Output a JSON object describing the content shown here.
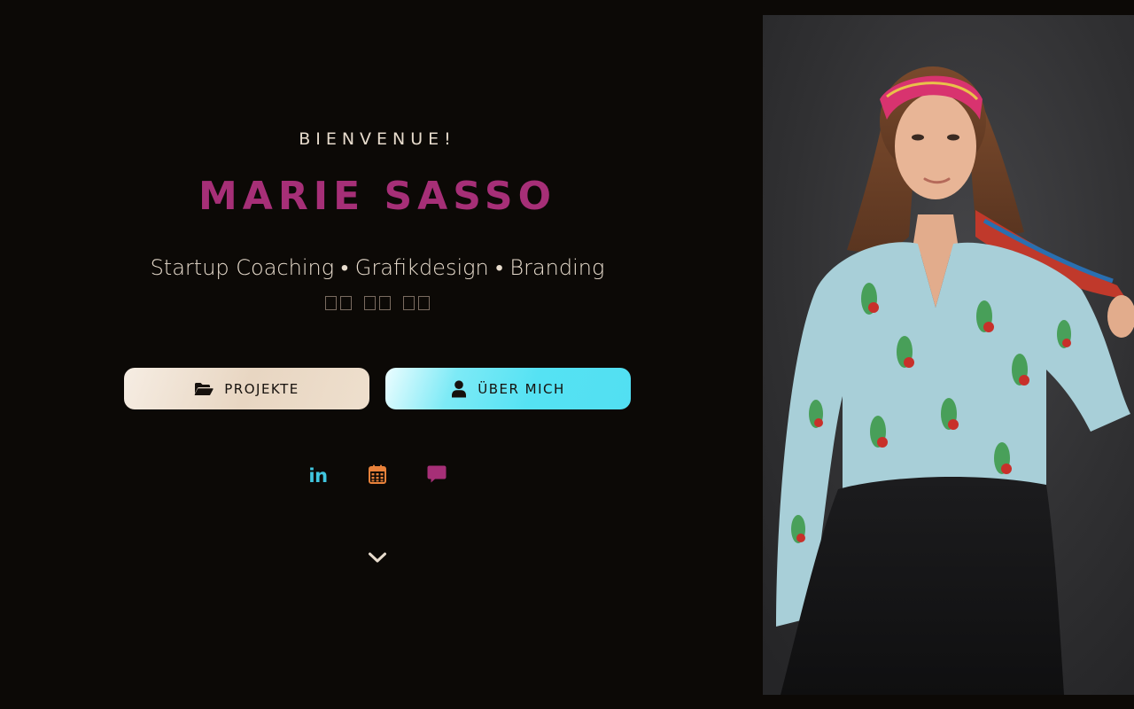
{
  "hero": {
    "greeting": "BIENVENUE!",
    "name": "MARIE SASSO",
    "tagline": "Startup Coaching • Grafikdesign • Branding",
    "glyph_groups": 3
  },
  "buttons": {
    "projects": {
      "label": "PROJEKTE",
      "icon": "folder-open-icon"
    },
    "about": {
      "label": "ÜBER MICH",
      "icon": "user-icon"
    }
  },
  "social": {
    "linkedin": {
      "text": "in",
      "icon": "linkedin-icon",
      "color": "#41c6df"
    },
    "calendar": {
      "icon": "calendar-icon",
      "color": "#e8813a"
    },
    "chat": {
      "icon": "chat-icon",
      "color": "#a62f77"
    }
  },
  "scroll": {
    "icon": "chevron-down-icon"
  },
  "photo": {
    "alt": "portrait-photo"
  },
  "colors": {
    "background": "#0c0906",
    "accent_name": "#a62f77",
    "text_light": "#e8dccd",
    "button_cyan": "#55e2f3",
    "button_beige": "#e8d6c2"
  }
}
